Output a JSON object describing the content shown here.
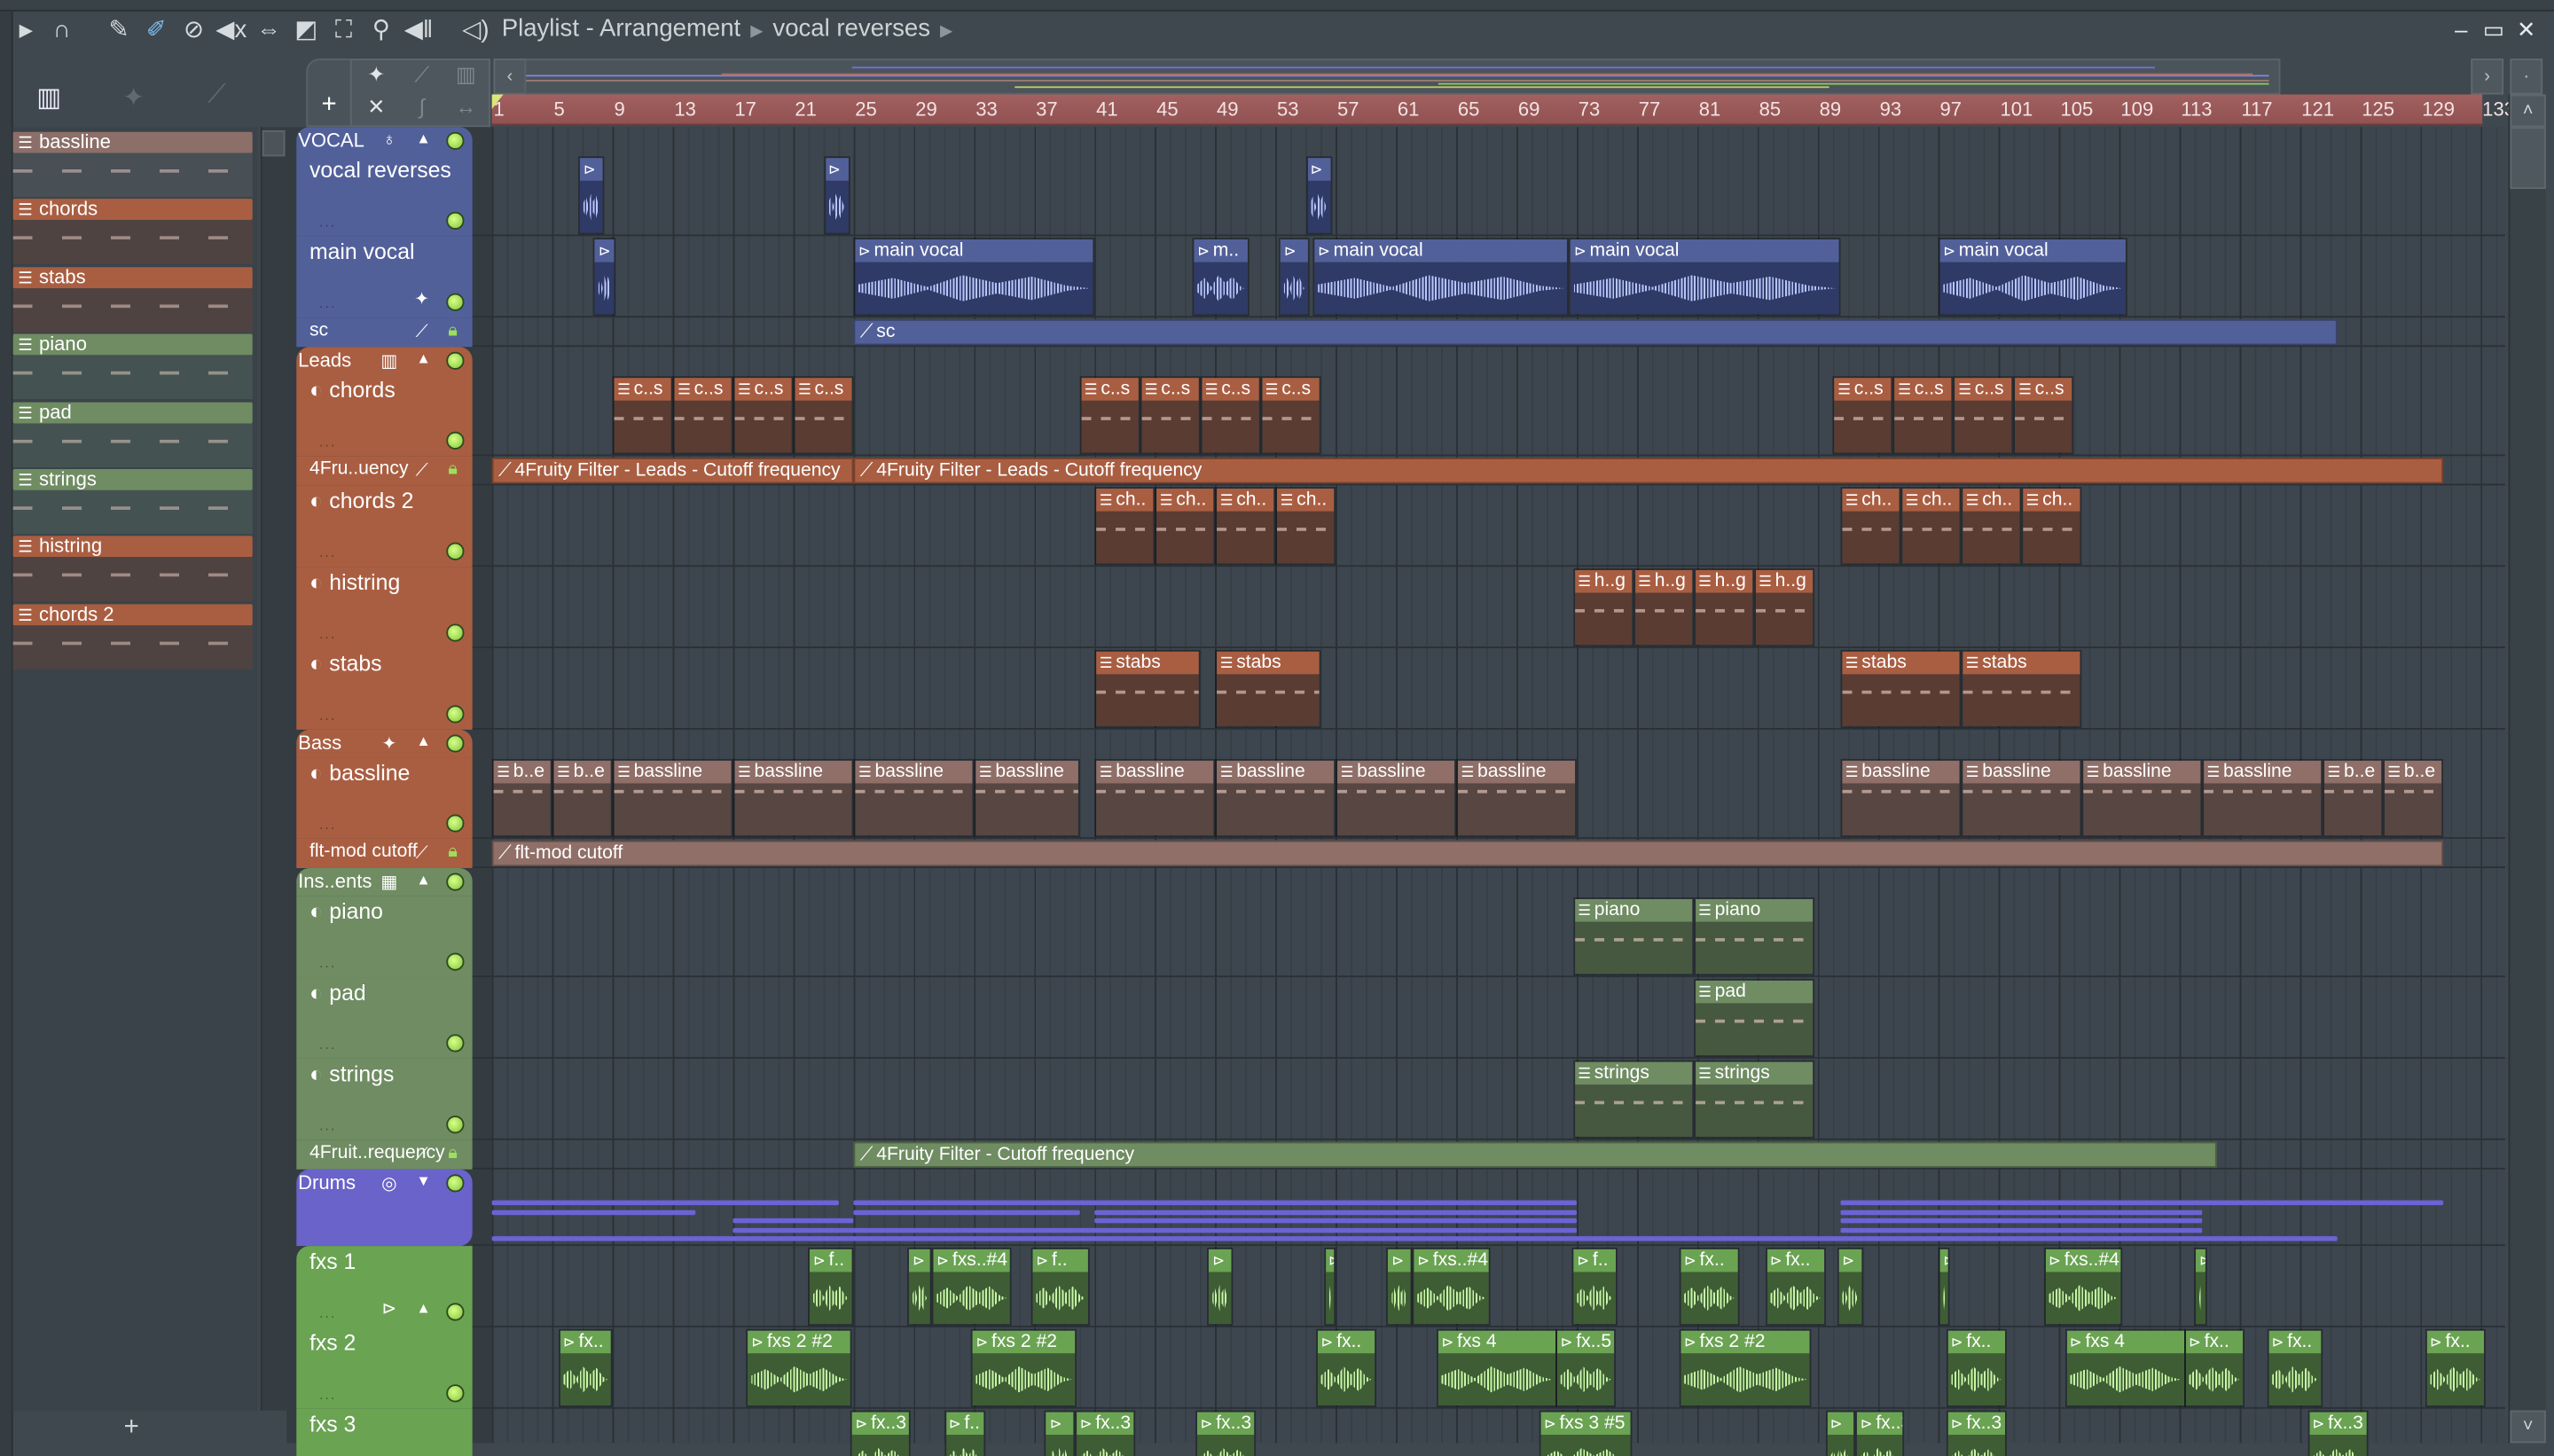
{
  "window": {
    "title": "Playlist - Arrangement",
    "breadcrumb": "vocal reverses"
  },
  "picker": {
    "add_label": "+",
    "items": [
      {
        "name": "bassline",
        "color": "#8c6f68",
        "body": "#4a5157"
      },
      {
        "name": "chords",
        "color": "#a95e42",
        "body": "#524442"
      },
      {
        "name": "stabs",
        "color": "#a95e42",
        "body": "#524442"
      },
      {
        "name": "piano",
        "color": "#6f8c62",
        "body": "#465552"
      },
      {
        "name": "pad",
        "color": "#6f8c62",
        "body": "#465552"
      },
      {
        "name": "strings",
        "color": "#6f8c62",
        "body": "#465552"
      },
      {
        "name": "histring",
        "color": "#a95e42",
        "body": "#524442"
      },
      {
        "name": "chords 2",
        "color": "#a95e42",
        "body": "#524442"
      }
    ]
  },
  "ruler": {
    "labels": [
      "1",
      "5",
      "9",
      "13",
      "17",
      "21",
      "25",
      "29",
      "33",
      "37",
      "41",
      "45",
      "49",
      "53",
      "57",
      "61",
      "65",
      "69",
      "73",
      "77",
      "81",
      "85",
      "89",
      "93",
      "97",
      "101",
      "105",
      "109",
      "113",
      "117",
      "121",
      "125",
      "129",
      "133"
    ]
  },
  "groups": [
    {
      "name": "VOCAL",
      "color": "#52609a",
      "icon": "microphone-icon",
      "glyph": "♁",
      "tracks": [
        {
          "name": "vocal reverses",
          "kind": "audio",
          "clips": [
            {
              "start": 6.75,
              "len": 1.75,
              "label": ""
            },
            {
              "start": 23,
              "len": 1.75,
              "label": ""
            },
            {
              "start": 55,
              "len": 1.75,
              "label": ""
            }
          ]
        },
        {
          "name": "main vocal",
          "kind": "audio",
          "clips": [
            {
              "start": 7.75,
              "len": 1.5,
              "label": ""
            },
            {
              "start": 25,
              "len": 16,
              "label": "main vocal"
            },
            {
              "start": 47.5,
              "len": 3.75,
              "label": "m.."
            },
            {
              "start": 53.25,
              "len": 2,
              "label": ""
            },
            {
              "start": 55.5,
              "len": 17,
              "label": "main vocal"
            },
            {
              "start": 72.5,
              "len": 18,
              "label": "main vocal"
            },
            {
              "start": 97,
              "len": 12.5,
              "label": "main vocal"
            }
          ]
        },
        {
          "name": "sc",
          "kind": "auto",
          "clips": [
            {
              "start": 25,
              "len": 98.5,
              "label": "sc"
            }
          ]
        }
      ]
    },
    {
      "name": "Leads",
      "color": "#a95e42",
      "icon": "piano-icon",
      "glyph": "▥",
      "tracks": [
        {
          "name": "chords",
          "kind": "pattern",
          "clips": [
            {
              "start": 9,
              "len": 4,
              "label": "c..s"
            },
            {
              "start": 13,
              "len": 4,
              "label": "c..s"
            },
            {
              "start": 17,
              "len": 4,
              "label": "c..s"
            },
            {
              "start": 21,
              "len": 4,
              "label": "c..s"
            },
            {
              "start": 40,
              "len": 4,
              "label": "c..s"
            },
            {
              "start": 44,
              "len": 4,
              "label": "c..s"
            },
            {
              "start": 48,
              "len": 4,
              "label": "c..s"
            },
            {
              "start": 52,
              "len": 4,
              "label": "c..s"
            },
            {
              "start": 90,
              "len": 4,
              "label": "c..s"
            },
            {
              "start": 94,
              "len": 4,
              "label": "c..s"
            },
            {
              "start": 98,
              "len": 4,
              "label": "c..s"
            },
            {
              "start": 102,
              "len": 4,
              "label": "c..s"
            }
          ]
        },
        {
          "name": "4Fru..uency",
          "kind": "auto",
          "clips": [
            {
              "start": 1,
              "len": 24,
              "label": "4Fruity Filter - Leads - Cutoff frequency"
            },
            {
              "start": 25,
              "len": 105.5,
              "label": "4Fruity Filter - Leads - Cutoff frequency"
            }
          ]
        },
        {
          "name": "chords 2",
          "kind": "pattern",
          "clips": [
            {
              "start": 41,
              "len": 4,
              "label": "ch.."
            },
            {
              "start": 45,
              "len": 4,
              "label": "ch.."
            },
            {
              "start": 49,
              "len": 4,
              "label": "ch.."
            },
            {
              "start": 53,
              "len": 4,
              "label": "ch.."
            },
            {
              "start": 90.5,
              "len": 4,
              "label": "ch.."
            },
            {
              "start": 94.5,
              "len": 4,
              "label": "ch.."
            },
            {
              "start": 98.5,
              "len": 4,
              "label": "ch.."
            },
            {
              "start": 102.5,
              "len": 4,
              "label": "ch.."
            }
          ]
        },
        {
          "name": "histring",
          "kind": "pattern",
          "clips": [
            {
              "start": 72.75,
              "len": 4,
              "label": "h..g"
            },
            {
              "start": 76.75,
              "len": 4,
              "label": "h..g"
            },
            {
              "start": 80.75,
              "len": 4,
              "label": "h..g"
            },
            {
              "start": 84.75,
              "len": 4,
              "label": "h..g"
            }
          ]
        },
        {
          "name": "stabs",
          "kind": "pattern",
          "clips": [
            {
              "start": 41,
              "len": 7,
              "label": "stabs"
            },
            {
              "start": 49,
              "len": 7,
              "label": "stabs"
            },
            {
              "start": 90.5,
              "len": 8,
              "label": "stabs"
            },
            {
              "start": 98.5,
              "len": 8,
              "label": "stabs"
            }
          ]
        }
      ]
    },
    {
      "name": "Bass",
      "color": "#a95e42",
      "icon": "waveform-icon",
      "glyph": "✦",
      "clip_color": "#8f6f68",
      "clip_body": "#574642",
      "tracks": [
        {
          "name": "bassline",
          "kind": "pattern",
          "clips": [
            {
              "start": 1,
              "len": 4,
              "label": "b..e"
            },
            {
              "start": 5,
              "len": 4,
              "label": "b..e"
            },
            {
              "start": 9,
              "len": 8,
              "label": "bassline"
            },
            {
              "start": 17,
              "len": 8,
              "label": "bassline"
            },
            {
              "start": 25,
              "len": 8,
              "label": "bassline"
            },
            {
              "start": 33,
              "len": 7,
              "label": "bassline"
            },
            {
              "start": 41,
              "len": 8,
              "label": "bassline"
            },
            {
              "start": 49,
              "len": 8,
              "label": "bassline"
            },
            {
              "start": 57,
              "len": 8,
              "label": "bassline"
            },
            {
              "start": 65,
              "len": 8,
              "label": "bassline"
            },
            {
              "start": 90.5,
              "len": 8,
              "label": "bassline"
            },
            {
              "start": 98.5,
              "len": 8,
              "label": "bassline"
            },
            {
              "start": 106.5,
              "len": 8,
              "label": "bassline"
            },
            {
              "start": 114.5,
              "len": 8,
              "label": "bassline"
            },
            {
              "start": 122.5,
              "len": 4,
              "label": "b..e"
            },
            {
              "start": 126.5,
              "len": 4,
              "label": "b..e"
            }
          ]
        },
        {
          "name": "flt-mod cutoff",
          "kind": "auto",
          "clips": [
            {
              "start": 1,
              "len": 129.5,
              "label": "flt-mod cutoff"
            }
          ]
        }
      ]
    },
    {
      "name": "Ins..ents",
      "color": "#6f8c62",
      "icon": "keyboard-icon",
      "glyph": "▦",
      "tracks": [
        {
          "name": "piano",
          "kind": "pattern",
          "clips": [
            {
              "start": 72.75,
              "len": 8,
              "label": "piano"
            },
            {
              "start": 80.75,
              "len": 8,
              "label": "piano"
            }
          ]
        },
        {
          "name": "pad",
          "kind": "pattern",
          "clips": [
            {
              "start": 80.75,
              "len": 8,
              "label": "pad"
            }
          ]
        },
        {
          "name": "strings",
          "kind": "pattern",
          "clips": [
            {
              "start": 72.75,
              "len": 8,
              "label": "strings"
            },
            {
              "start": 80.75,
              "len": 8,
              "label": "strings"
            }
          ]
        },
        {
          "name": "4Fruit..requency",
          "kind": "auto",
          "clips": [
            {
              "start": 25,
              "len": 90.5,
              "label": "4Fruity Filter - Cutoff frequency"
            }
          ]
        }
      ]
    },
    {
      "name": "Drums",
      "color": "#6a63c9",
      "icon": "drums-icon",
      "glyph": "◎",
      "collapsed": true,
      "lanes": [
        [
          {
            "start": 1,
            "len": 23
          },
          {
            "start": 25,
            "len": 48
          },
          {
            "start": 90.5,
            "len": 40
          }
        ],
        [
          {
            "start": 1,
            "len": 13.5
          },
          {
            "start": 25,
            "len": 15
          },
          {
            "start": 41,
            "len": 32
          },
          {
            "start": 90.5,
            "len": 24
          }
        ],
        [
          {
            "start": 17,
            "len": 8
          },
          {
            "start": 41,
            "len": 32
          },
          {
            "start": 90.5,
            "len": 24
          }
        ],
        [
          {
            "start": 17,
            "len": 56
          },
          {
            "start": 90.5,
            "len": 24
          }
        ],
        [
          {
            "start": 1,
            "len": 122.5
          }
        ]
      ],
      "tracks": []
    },
    {
      "name": "",
      "color": "#6aa352",
      "clip_color": "#6aa352",
      "clip_body": "#3e5d34",
      "wave": "#c8f7a6",
      "tracks": [
        {
          "name": "fxs 1",
          "kind": "audio",
          "clips": [
            {
              "start": 22,
              "len": 3,
              "label": "f.."
            },
            {
              "start": 28.6,
              "len": 1.6,
              "label": ""
            },
            {
              "start": 30.2,
              "len": 5.3,
              "label": "fxs..#4"
            },
            {
              "start": 36.8,
              "len": 3.9,
              "label": "f.."
            },
            {
              "start": 48.5,
              "len": 1.7,
              "label": ""
            },
            {
              "start": 56.2,
              "len": 0.8,
              "label": ""
            },
            {
              "start": 60.4,
              "len": 1.7,
              "label": ""
            },
            {
              "start": 62.1,
              "len": 5.2,
              "label": "fxs..#4"
            },
            {
              "start": 72.7,
              "len": 3,
              "label": "f.."
            },
            {
              "start": 79.8,
              "len": 4,
              "label": "fx.."
            },
            {
              "start": 85.5,
              "len": 4,
              "label": "fx.."
            },
            {
              "start": 90.3,
              "len": 1.7,
              "label": ""
            },
            {
              "start": 97,
              "len": 0.8,
              "label": ""
            },
            {
              "start": 104,
              "len": 5.2,
              "label": "fxs..#4"
            },
            {
              "start": 114,
              "len": 0.8,
              "label": ""
            }
          ]
        },
        {
          "name": "fxs 2",
          "kind": "audio",
          "clips": [
            {
              "start": 5.4,
              "len": 3.6,
              "label": "fx.."
            },
            {
              "start": 17.9,
              "len": 7,
              "label": "fxs 2 #2"
            },
            {
              "start": 32.8,
              "len": 7,
              "label": "fxs 2 #2"
            },
            {
              "start": 55.7,
              "len": 4,
              "label": "fx.."
            },
            {
              "start": 63.7,
              "len": 8,
              "label": "fxs 4"
            },
            {
              "start": 71.6,
              "len": 4,
              "label": "fx..5"
            },
            {
              "start": 79.8,
              "len": 8.8,
              "label": "fxs 2 #2"
            },
            {
              "start": 97.5,
              "len": 4,
              "label": "fx.."
            },
            {
              "start": 105.4,
              "len": 8,
              "label": "fxs 4"
            },
            {
              "start": 113.3,
              "len": 4,
              "label": "fx.."
            },
            {
              "start": 118.8,
              "len": 3.7,
              "label": "fx.."
            },
            {
              "start": 129.3,
              "len": 4,
              "label": "fx.."
            }
          ]
        },
        {
          "name": "fxs 3",
          "kind": "audio",
          "clips": [
            {
              "start": 24.8,
              "len": 4,
              "label": "fx..3"
            },
            {
              "start": 31,
              "len": 2.8,
              "label": "f.."
            },
            {
              "start": 37.7,
              "len": 2,
              "label": ""
            },
            {
              "start": 39.7,
              "len": 4,
              "label": "fx..3"
            },
            {
              "start": 47.7,
              "len": 4,
              "label": "fx..3"
            },
            {
              "start": 70.5,
              "len": 6.2,
              "label": "fxs 3 #5"
            },
            {
              "start": 89.5,
              "len": 2,
              "label": ""
            },
            {
              "start": 91.5,
              "len": 3.2,
              "label": "fx..3"
            },
            {
              "start": 97.5,
              "len": 4,
              "label": "fx..3"
            },
            {
              "start": 121.5,
              "len": 4,
              "label": "fx..3"
            }
          ]
        }
      ]
    }
  ]
}
